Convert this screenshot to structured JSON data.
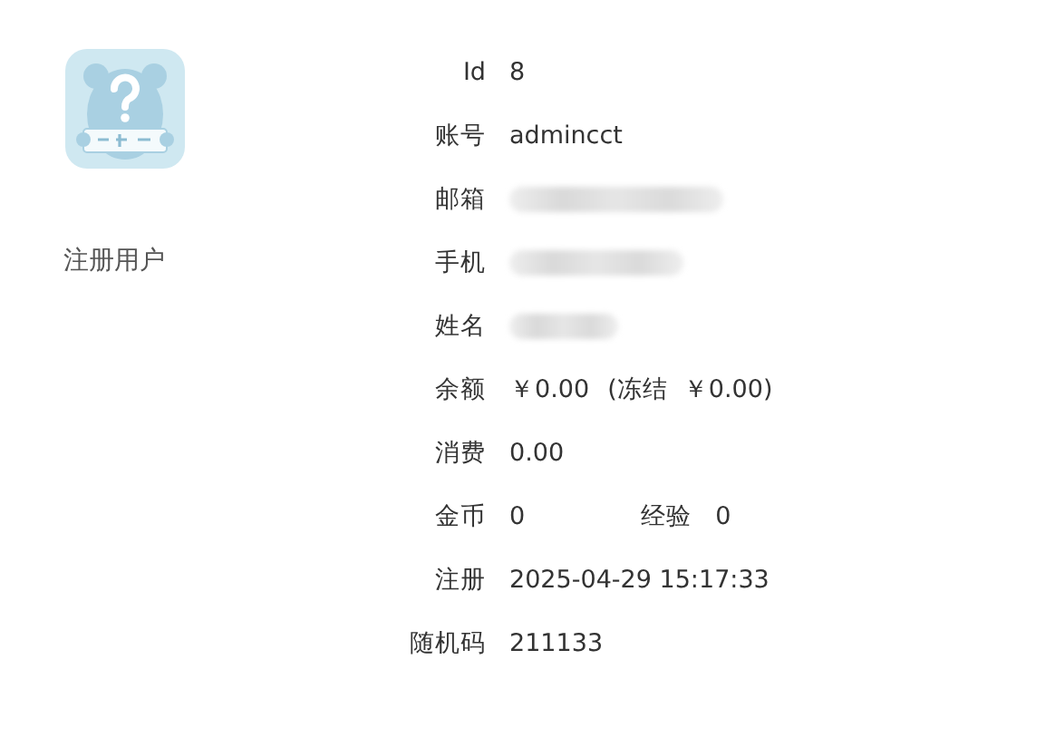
{
  "profile": {
    "role": "注册用户"
  },
  "fields": [
    {
      "kind": "text",
      "label": "Id",
      "value": "8"
    },
    {
      "kind": "text",
      "label": "账号",
      "value": "admincct"
    },
    {
      "kind": "redacted",
      "label": "邮箱"
    },
    {
      "kind": "redacted",
      "label": "手机"
    },
    {
      "kind": "redacted",
      "label": "姓名"
    },
    {
      "kind": "balance",
      "label": "余额",
      "value": "￥0.00",
      "frozen": "(冻结  ￥0.00)"
    },
    {
      "kind": "text",
      "label": "消费",
      "value": "0.00"
    },
    {
      "kind": "pair",
      "label": "金币",
      "value": "0",
      "label_2": "经验",
      "value_2": "0"
    },
    {
      "kind": "text",
      "label": "注册",
      "value": "2025-04-29 15:17:33"
    },
    {
      "kind": "text",
      "label": "随机码",
      "value": "211133"
    }
  ]
}
